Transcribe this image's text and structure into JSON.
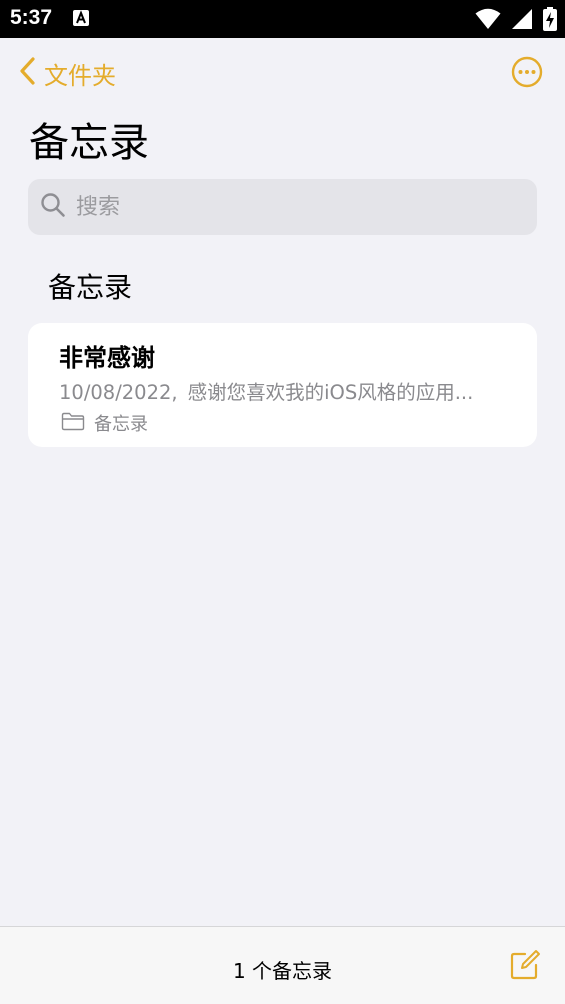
{
  "status_bar": {
    "time": "5:37",
    "icons": [
      "text-a-icon",
      "wifi-icon",
      "cellular-signal-icon",
      "battery-charging-icon"
    ]
  },
  "nav": {
    "back_label": "文件夹",
    "back_icon": "chevron-left-icon",
    "more_icon": "ellipsis-circle-icon"
  },
  "page": {
    "title": "备忘录"
  },
  "search": {
    "placeholder": "搜索",
    "value": ""
  },
  "section": {
    "title": "备忘录"
  },
  "notes": [
    {
      "title": "非常感谢",
      "date": "10/08/2022,",
      "preview": "感谢您喜欢我的iOS风格的应用...",
      "folder": "备忘录",
      "folder_icon": "folder-icon"
    }
  ],
  "bottom_bar": {
    "count_text": "1 个备忘录",
    "compose_icon": "compose-icon"
  },
  "colors": {
    "accent": "#e4ac2c",
    "background": "#f2f2f7",
    "card": "#ffffff",
    "secondary_text": "#8a8a8e",
    "search_bg": "#e4e4e9"
  }
}
